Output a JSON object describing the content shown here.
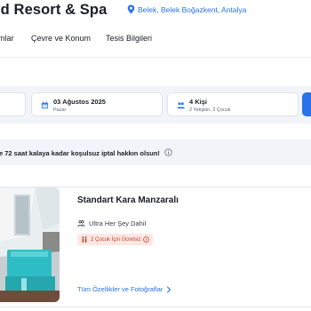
{
  "hotel": {
    "title": "ld Resort & Spa",
    "location": "Belek, Belek Boğazkent, Antalya"
  },
  "tabs": [
    {
      "label": "mlar"
    },
    {
      "label": "Çevre ve Konum"
    },
    {
      "label": "Tesis Bilgileri"
    }
  ],
  "search": {
    "date_main": "03 Ağustos 2025",
    "date_sub": "Pazar",
    "guests_main": "4 Kişi",
    "guests_sub": "2 Yetişkin, 2 Çocuk"
  },
  "banner": {
    "text": "e 72 saat kalaya kadar koşulsuz iptal hakkın olsun!"
  },
  "room": {
    "name": "Standart Kara Manzaralı",
    "board": "Ultra Her Şey Dahil",
    "child_badge": "2 Çocuk İçin Ücretsiz",
    "details_link": "Tüm Özellikler ve Fotoğraflar"
  },
  "colors": {
    "accent": "#2a72ec",
    "badge_bg": "#fde7e3",
    "badge_text": "#c2402c",
    "panel_bg": "#f1f4f9"
  },
  "icons": {
    "location": "map-pin-icon",
    "calendar": "calendar-icon",
    "guests": "people-icon",
    "info": "info-circle-icon",
    "board": "utensils-icon",
    "child": "child-icon",
    "chevron": "chevron-right-icon"
  }
}
